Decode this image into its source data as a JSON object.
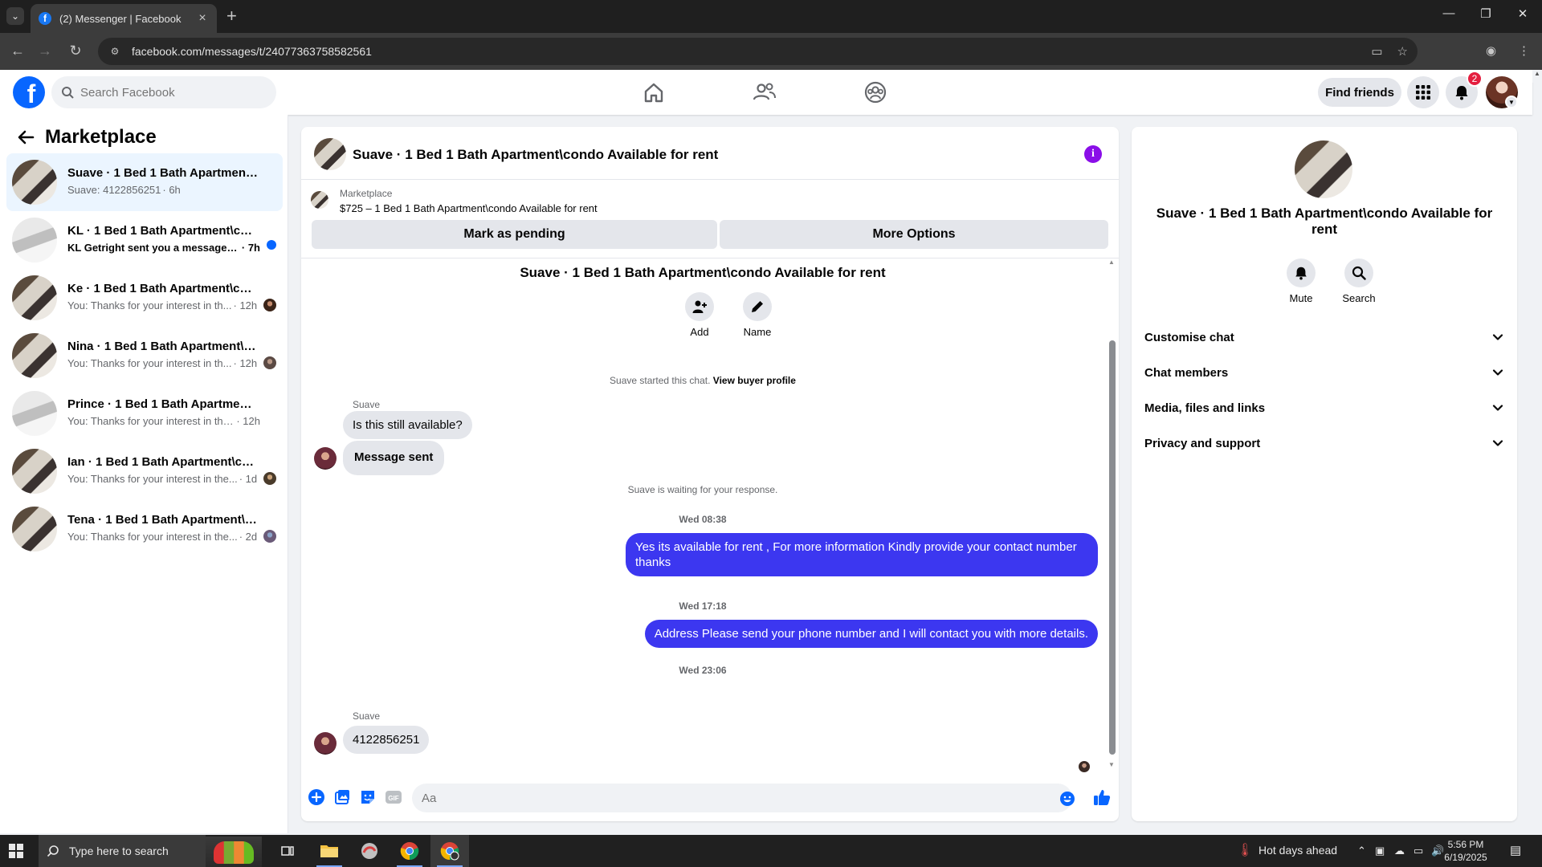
{
  "browser": {
    "tab_title": "(2) Messenger | Facebook",
    "favicon_letter": "f",
    "new_tab": "+",
    "url": "facebook.com/messages/t/24077363758582561",
    "minimize": "—",
    "maximize": "❐",
    "close": "✕"
  },
  "fb": {
    "logo_letter": "f",
    "search_placeholder": "Search Facebook",
    "find_friends": "Find friends",
    "notification_count": "2"
  },
  "sidebar": {
    "title": "Marketplace",
    "conversations": [
      {
        "name": "Suave · 1 Bed 1 Bath Apartment\\condo Available for rent",
        "preview": "Suave: 4122856251",
        "time": " · 6h",
        "active": true
      },
      {
        "name": "KL · 1 Bed 1 Bath Apartment\\condo Available for rent",
        "preview": "KL Getright sent you a message ab...",
        "time": " · 7h",
        "unread": true
      },
      {
        "name": "Ke · 1 Bed 1 Bath Apartment\\condo Available for rent",
        "preview": "You: Thanks for your interest in th...",
        "time": " · 12h"
      },
      {
        "name": "Nina · 1 Bed 1 Bath Apartment\\condo Available for rent",
        "preview": "You: Thanks for your interest in th...",
        "time": " · 12h"
      },
      {
        "name": "Prince · 1 Bed 1 Bath Apartment\\condo Available for rent",
        "preview": "You: Thanks for your interest in the h...",
        "time": " · 12h"
      },
      {
        "name": "Ian · 1 Bed 1 Bath Apartment\\condo Available for rent",
        "preview": "You: Thanks for your interest in the...",
        "time": " · 1d"
      },
      {
        "name": "Tena · 1 Bed 1 Bath Apartment\\condo Available for rent",
        "preview": "You: Thanks for your interest in the...",
        "time": " · 2d"
      }
    ]
  },
  "chat": {
    "title": "Suave · 1 Bed 1 Bath Apartment\\condo Available for rent",
    "listing_source": "Marketplace",
    "listing_price": "$725 – 1 Bed 1 Bath Apartment\\condo Available for rent",
    "mark_pending": "Mark as pending",
    "more_options": "More Options",
    "add_label": "Add",
    "name_label": "Name",
    "started_note": "Suave started this chat.",
    "view_buyer_profile": "View buyer profile",
    "sender": "Suave",
    "msg_1": "Is this still available?",
    "msg_2": "Message sent",
    "waiting_note": "Suave is waiting for your response.",
    "ts_1": "Wed 08:38",
    "out_1": "Yes its  available for rent , For more information Kindly provide your contact number thanks",
    "ts_2": "Wed 17:18",
    "out_2": "Address  Please send your phone number and I will contact you with more details.",
    "ts_3": "Wed 23:06",
    "msg_3": "4122856251",
    "composer_placeholder": "Aa"
  },
  "details": {
    "title": "Suave · 1 Bed 1 Bath Apartment\\condo Available for rent",
    "mute": "Mute",
    "search": "Search",
    "sections": [
      "Customise chat",
      "Chat members",
      "Media, files and links",
      "Privacy and support"
    ]
  },
  "taskbar": {
    "search_placeholder": "Type here to search",
    "weather": "Hot days ahead",
    "time": "5:56 PM",
    "date": "6/19/2025"
  },
  "colors": {
    "fb_blue": "#0866ff",
    "outgoing_bubble": "#3c37f0",
    "active_conversation": "#ebf5ff",
    "info_purple": "#8a0ee8"
  }
}
